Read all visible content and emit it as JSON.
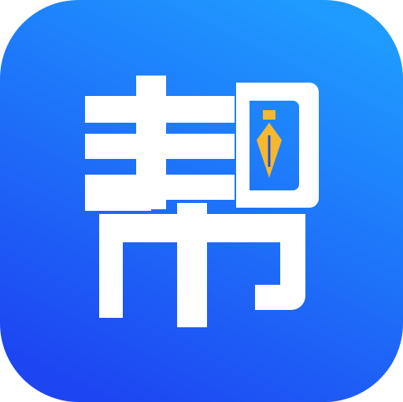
{
  "icon": {
    "name": "帮",
    "glyph": "帮",
    "colors": {
      "background_top": "#1f9bff",
      "background_bottom": "#1d45f2",
      "glyph": "#ffffff",
      "pen_nib": "#f5b82e",
      "pen_outline": "#1d4fe0"
    }
  }
}
